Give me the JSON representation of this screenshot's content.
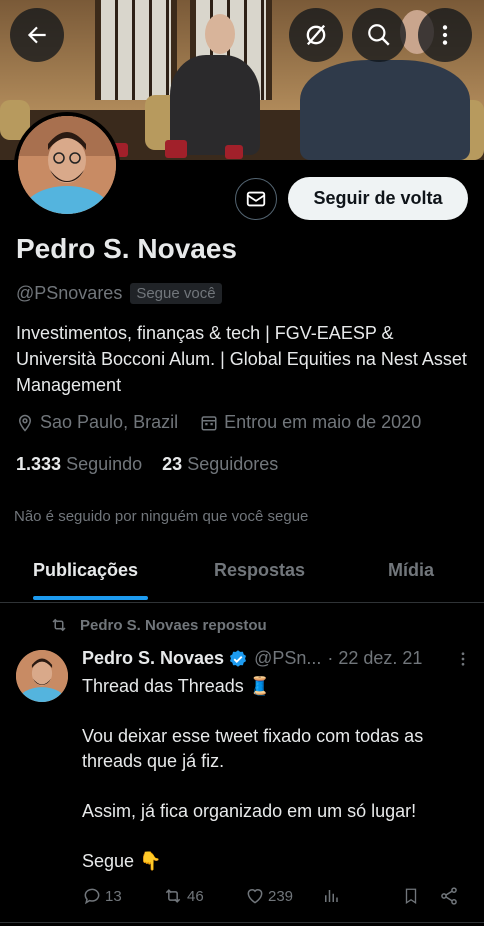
{
  "header": {
    "back_icon": "arrow-left-icon",
    "filter_icon": "slashed-circle-icon",
    "search_icon": "search-icon",
    "more_icon": "more-vertical-icon"
  },
  "profile": {
    "name": "Pedro S. Novaes",
    "handle": "@PSnovares",
    "follows_you_badge": "Segue você",
    "bio": "Investimentos, finanças & tech | FGV-EAESP & Università Bocconi Alum. | Global Equities na Nest Asset Management",
    "location": "Sao Paulo, Brazil",
    "joined": "Entrou em maio de 2020",
    "following_count": "1.333",
    "following_label": "Seguindo",
    "followers_count": "23",
    "followers_label": "Seguidores",
    "followed_by_note": "Não é seguido por ninguém que você segue"
  },
  "actions": {
    "message_icon": "envelope-icon",
    "follow_back_label": "Seguir de volta"
  },
  "tabs": [
    {
      "label": "Publicações",
      "active": true
    },
    {
      "label": "Respostas",
      "active": false
    },
    {
      "label": "Mídia",
      "active": false
    }
  ],
  "tweet": {
    "repost_label": "Pedro S. Novaes repostou",
    "author_name": "Pedro S. Novaes",
    "author_handle": "@PSn...",
    "date": "· 22 dez. 21",
    "lines": [
      "Thread das Threads 🧵",
      "Vou deixar esse tweet fixado com todas as threads que já fiz.",
      "Assim, já fica organizado em um só lugar!",
      "Segue 👇"
    ],
    "replies": "13",
    "retweets": "46",
    "likes": "239"
  },
  "colors": {
    "background": "#000000",
    "accent": "#1d9bf0",
    "text_primary": "#e7e9ea",
    "text_secondary": "#71767b",
    "verified": "#1d9bf0"
  }
}
